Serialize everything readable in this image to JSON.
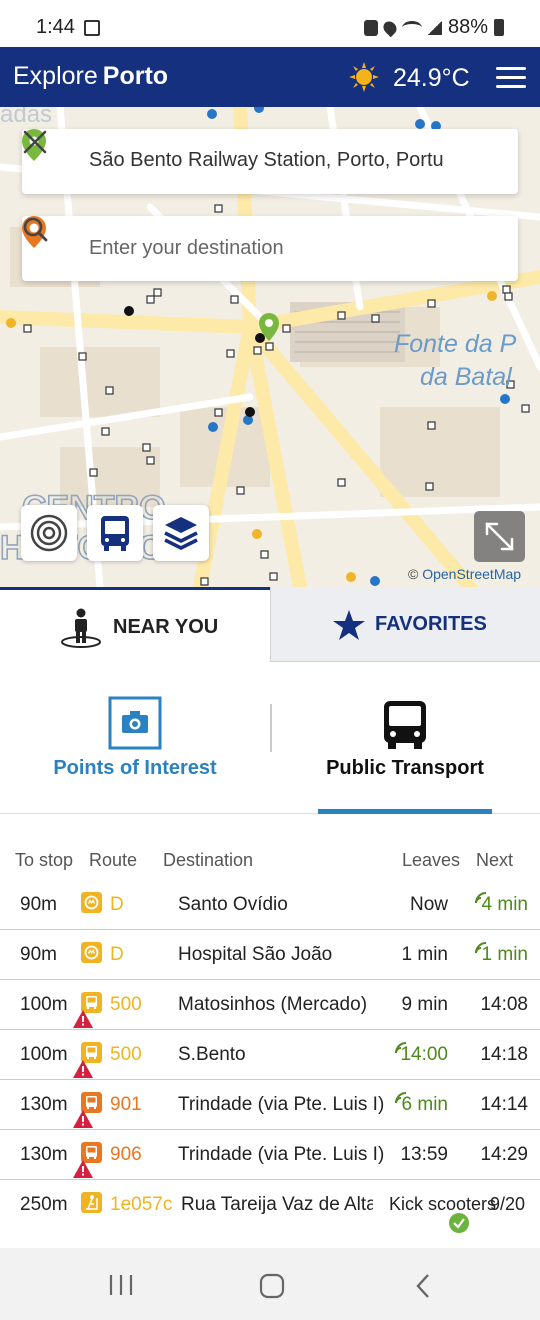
{
  "status_bar": {
    "time": "1:44",
    "battery": "88%"
  },
  "header": {
    "brand_light": "Explore",
    "brand_bold": "Porto",
    "temperature": "24.9°C"
  },
  "search": {
    "origin_value": "São Bento Railway Station, Porto, Portu",
    "destination_placeholder": "Enter your destination"
  },
  "map": {
    "labels": [
      "Fonte da P",
      "da Batal",
      "CENTRO",
      "HISTÓRICO"
    ],
    "attribution_prefix": "© ",
    "attribution_link": "OpenStreetMap"
  },
  "tabs": {
    "near_you": "NEAR YOU",
    "favorites": "FAVORITES"
  },
  "subtabs": {
    "poi": "Points of Interest",
    "transport": "Public Transport"
  },
  "table": {
    "headers": {
      "to_stop": "To stop",
      "route": "Route",
      "destination": "Destination",
      "leaves": "Leaves",
      "next": "Next"
    },
    "rows": [
      {
        "to_stop": "90m",
        "route": "D",
        "route_type": "metro",
        "destination": "Santo Ovídio",
        "leaves": "Now",
        "next": "4 min",
        "leaves_rt": false,
        "next_rt": true,
        "warning": false
      },
      {
        "to_stop": "90m",
        "route": "D",
        "route_type": "metro",
        "destination": "Hospital São João",
        "leaves": "1 min",
        "next": "1 min",
        "leaves_rt": false,
        "next_rt": true,
        "warning": false
      },
      {
        "to_stop": "100m",
        "route": "500",
        "route_type": "bus-yellow",
        "destination": "Matosinhos (Mercado)",
        "leaves": "9 min",
        "next": "14:08",
        "leaves_rt": false,
        "next_rt": false,
        "warning": true
      },
      {
        "to_stop": "100m",
        "route": "500",
        "route_type": "bus-yellow",
        "destination": "S.Bento",
        "leaves": "14:00",
        "next": "14:18",
        "leaves_rt": true,
        "next_rt": false,
        "warning": true
      },
      {
        "to_stop": "130m",
        "route": "901",
        "route_type": "bus-orange",
        "destination": "Trindade (via Pte. Luis I)",
        "leaves": "6 min",
        "next": "14:14",
        "leaves_rt": true,
        "next_rt": false,
        "warning": true
      },
      {
        "to_stop": "130m",
        "route": "906",
        "route_type": "bus-orange",
        "destination": "Trindade (via Pte. Luis I)",
        "leaves": "13:59",
        "next": "14:29",
        "leaves_rt": false,
        "next_rt": false,
        "warning": true
      },
      {
        "to_stop": "250m",
        "route": "1e057c",
        "route_type": "scooter",
        "destination": "Rua Tareija Vaz de Altaro",
        "leaves": "Kick scooters",
        "next": "9/20",
        "leaves_rt": false,
        "next_rt": false,
        "warning": false
      }
    ]
  },
  "colors": {
    "brand_blue": "#15307f",
    "accent_blue": "#2a82c2",
    "metro_yellow": "#f0b423",
    "bus_orange": "#e87722",
    "realtime_green": "#4d8a17",
    "warning_red": "#d62040"
  }
}
